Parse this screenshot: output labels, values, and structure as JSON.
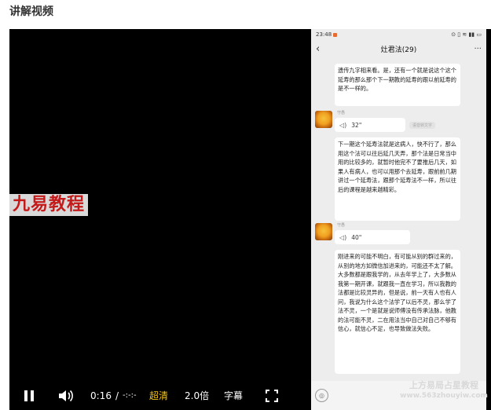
{
  "page": {
    "title": "讲解视频"
  },
  "video": {
    "watermark": "九易教程",
    "controls": {
      "current_time": "0:16",
      "separator": "/",
      "duration": "-:-:-",
      "quality": "超清",
      "speed": "2.0倍",
      "subtitles": "字幕",
      "icons": {
        "play_state": "pause-icon",
        "volume": "volume-icon",
        "fullscreen": "fullscreen-icon"
      },
      "quality_color": "#f5c518"
    }
  },
  "phone": {
    "status": {
      "time": "23:48",
      "right": "⊙ ▯ ≋ ▮▮ ▭"
    },
    "header": {
      "title": "灶君法(29)",
      "back": "‹",
      "more": "···"
    },
    "messages": [
      {
        "text": "遗传九字相来看。是，还有一个就是说这个这个延寿的那么那个下一期教的延寿的跟以前延寿的是不一样的。"
      },
      {
        "sender": "守愚",
        "duration": "32\"",
        "note": "语音转文字"
      },
      {
        "text": "下一期这个延寿法就是这病人，快不行了，那么用这个法可以往后延几天弄，那个法是日常当中用的比较多的，就暂时他完不了要推后几天，如果人有病人，也可以用那个去延寿，跟前前几期讲过一个延寿法，跟那个延寿法不一样，所以往后的课程是越来越精彩。"
      },
      {
        "sender": "守愚",
        "duration": "40\""
      },
      {
        "text": "刚进来的可能不明白，有可能从别的群过来的，从别的地方如微信加进来的，可能还不太了解。大多数都是跟我学的，从去年学上了，大多数从我第一期开课，就跟我一直在学习，所以我教的法都是比较灵异的，但是说，前一天有人也有人问，我说为什么这个法学了以后不灵，那么学了法不灵，一个是就是说师傅没有传承法脉，他教的法可能不灵，二在用法当中自己对自己不够有信心，就信心不足，也导致做法失败。"
      }
    ],
    "input": {
      "mic": "◎"
    },
    "site_watermark": {
      "line1": "上方易局占星教程",
      "line2": "www.563zhouyiw.com"
    }
  }
}
